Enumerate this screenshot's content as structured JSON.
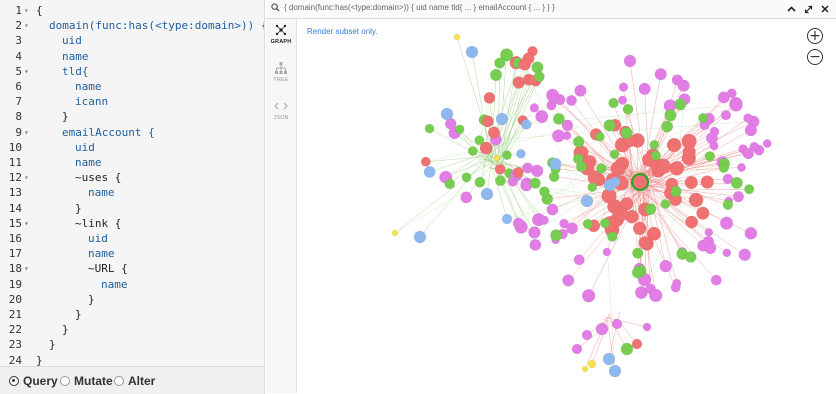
{
  "editor": {
    "lines": [
      {
        "n": "1",
        "fold": "v",
        "t": "{",
        "c": "pl",
        "i": 0
      },
      {
        "n": "2",
        "fold": "v",
        "t": "domain(func:has(<type:domain>)) {",
        "c": "kw",
        "i": 1
      },
      {
        "n": "3",
        "fold": "",
        "t": "uid",
        "c": "kw",
        "i": 2
      },
      {
        "n": "4",
        "fold": "",
        "t": "name",
        "c": "kw",
        "i": 2
      },
      {
        "n": "5",
        "fold": "v",
        "t": "tld{",
        "c": "kw",
        "i": 2
      },
      {
        "n": "6",
        "fold": "",
        "t": "name",
        "c": "kw",
        "i": 3
      },
      {
        "n": "7",
        "fold": "",
        "t": "icann",
        "c": "kw",
        "i": 3
      },
      {
        "n": "8",
        "fold": "",
        "t": "}",
        "c": "pl",
        "i": 2
      },
      {
        "n": "9",
        "fold": "v",
        "t": "emailAccount {",
        "c": "kw",
        "i": 2
      },
      {
        "n": "10",
        "fold": "",
        "t": "uid",
        "c": "kw",
        "i": 3
      },
      {
        "n": "11",
        "fold": "",
        "t": "name",
        "c": "kw",
        "i": 3
      },
      {
        "n": "12",
        "fold": "v",
        "t": "~uses {",
        "c": "pl",
        "i": 3
      },
      {
        "n": "13",
        "fold": "",
        "t": "name",
        "c": "kw",
        "i": 4
      },
      {
        "n": "14",
        "fold": "",
        "t": "}",
        "c": "pl",
        "i": 3
      },
      {
        "n": "15",
        "fold": "v",
        "t": "~link {",
        "c": "pl",
        "i": 3
      },
      {
        "n": "16",
        "fold": "",
        "t": "uid",
        "c": "kw",
        "i": 4
      },
      {
        "n": "17",
        "fold": "",
        "t": "name",
        "c": "kw",
        "i": 4
      },
      {
        "n": "18",
        "fold": "v",
        "t": "~URL {",
        "c": "pl",
        "i": 4
      },
      {
        "n": "19",
        "fold": "",
        "t": "name",
        "c": "kw",
        "i": 5
      },
      {
        "n": "20",
        "fold": "",
        "t": "}",
        "c": "pl",
        "i": 4
      },
      {
        "n": "21",
        "fold": "",
        "t": "}",
        "c": "pl",
        "i": 3
      },
      {
        "n": "22",
        "fold": "",
        "t": "}",
        "c": "pl",
        "i": 2
      },
      {
        "n": "23",
        "fold": "",
        "t": "}",
        "c": "pl",
        "i": 1
      },
      {
        "n": "24",
        "fold": "",
        "t": "}",
        "c": "pl",
        "i": 0
      }
    ]
  },
  "modes": {
    "query": "Query",
    "mutate": "Mutate",
    "alter": "Alter",
    "selected": "query"
  },
  "query_bar": {
    "text": "{ domain(func:has(<type:domain>)) { uid name tld{ ... } emailAccount { ... } } }"
  },
  "view_tabs": {
    "graph": "GRAPH",
    "tree": "TREE",
    "json": "JSON",
    "active": "graph"
  },
  "graph": {
    "note": "Render subset only.",
    "zoom_in": "+",
    "zoom_out": "−"
  },
  "colors": {
    "email_account": "#ef7171",
    "link": "#e27de5",
    "domain": "#76cd4f",
    "tld": "#8fb8ef",
    "url": "#f5e14b",
    "selected_outline": "#2aa52a",
    "edge_red": "#f08c8c",
    "edge_green": "#9ccf80",
    "note_blue": "#3a7bd5"
  }
}
